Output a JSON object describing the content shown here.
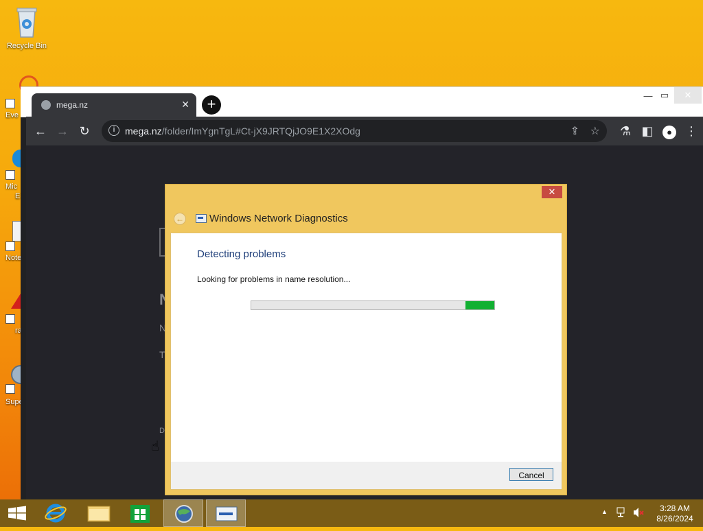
{
  "desktop": {
    "recycle_bin_label": "Recycle Bin",
    "partial_labels": [
      "Eve",
      "Mic",
      "E",
      "Note",
      "ra",
      "Supe"
    ]
  },
  "browser": {
    "tab_title": "mega.nz",
    "url_host": "mega.nz",
    "url_path": "/folder/ImYgnTgL#Ct-jX9JRTQjJO9E1X2XOdg",
    "page_partial_text": [
      "N",
      "N",
      "T",
      "D"
    ]
  },
  "dialog": {
    "title": "Windows Network Diagnostics",
    "heading": "Detecting problems",
    "status": "Looking for problems in name resolution...",
    "progress_start_fraction": 0.88,
    "progress_end_fraction": 1.0,
    "cancel_label": "Cancel",
    "close_glyph": "✕"
  },
  "taskbar": {
    "clock_time": "3:28 AM",
    "clock_date": "8/26/2024"
  },
  "colors": {
    "progress": "#12b032",
    "dialog_frame": "#f0c75e",
    "taskbar": "#7a5c16"
  }
}
